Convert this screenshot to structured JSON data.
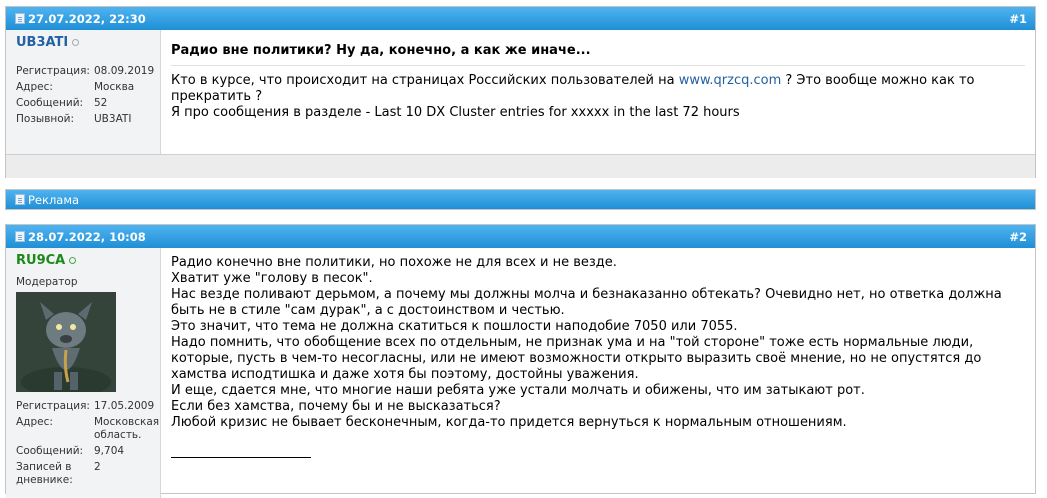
{
  "post1": {
    "date": "27.07.2022, 22:30",
    "number": "#1",
    "user": {
      "name": "UB3ATI",
      "meta": [
        {
          "k": "Регистрация:",
          "v": "08.09.2019"
        },
        {
          "k": "Адрес:",
          "v": "Москва"
        },
        {
          "k": "Сообщений:",
          "v": "52"
        },
        {
          "k": "Позывной:",
          "v": "UB3ATI"
        }
      ]
    },
    "title": "Радио вне политики? Ну да, конечно, а как же иначе...",
    "text_before_link": "Кто в курсе, что происходит на страницах Российских пользователей на",
    "link": "www.qrzcq.com",
    "text_after_link": "? Это вообще можно как то прекратить ?",
    "text_line3": "Я про сообщения в разделе - Last 10 DX Cluster entries for xxxxx in the last 72 hours"
  },
  "ad": {
    "label": "Реклама"
  },
  "post2": {
    "date": "28.07.2022, 10:08",
    "number": "#2",
    "user": {
      "name": "RU9CA",
      "role": "Модератор",
      "meta": [
        {
          "k": "Регистрация:",
          "v": "17.05.2009"
        },
        {
          "k": "Адрес:",
          "v": "Московская область."
        },
        {
          "k": "Сообщений:",
          "v": "9,704"
        },
        {
          "k": "Записей в дневнике:",
          "v": "2"
        }
      ]
    },
    "lines": [
      "Радио конечно вне политики, но похоже не для всех и не везде.",
      "Хватит уже \"голову в песок\".",
      "Нас везде поливают дерьмом, а почему мы должны молча и безнаказанно обтекать? Очевидно нет, но ответка должна быть не в стиле \"сам дурак\", а с достоинством и честью.",
      "Это значит, что тема не должна скатиться к пошлости наподобие 7050 или 7055.",
      "Надо помнить, что обобщение всех по отдельным, не признак ума и на \"той стороне\" тоже есть нормальные люди, которые, пусть в чем-то несогласны, или не имеют возможности открыто выразить своё мнение, но не опустятся до хамства исподтишка и даже хотя бы поэтому, достойны уважения.",
      "И еще, сдается мне, что многие наши ребята уже устали молчать и обижены, что им затыкают рот.",
      "Если без хамства, почему бы и не высказаться?",
      "Любой кризис не бывает бесконечным, когда-то придется вернуться к нормальным отношениям."
    ]
  },
  "colors": {
    "header_blue": "#1f8fd6",
    "username_blue": "#2461a3",
    "username_green": "#1a8a1a",
    "sidebar_bg": "#f2f3f5"
  }
}
